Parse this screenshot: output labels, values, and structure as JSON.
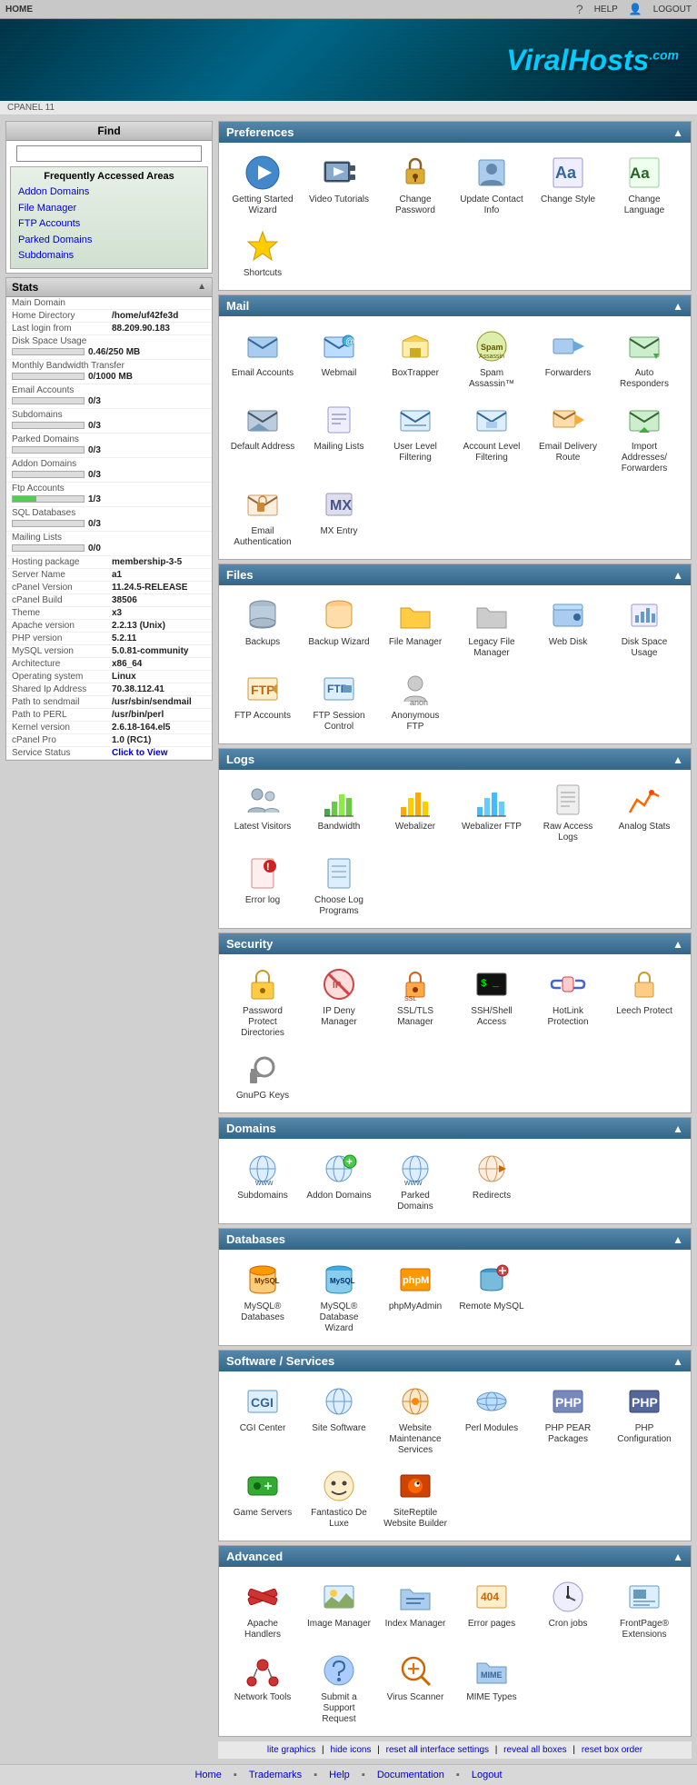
{
  "topbar": {
    "left": "HOME",
    "help": "HELP",
    "logout": "LOGOUT"
  },
  "header": {
    "logo_viral": "Viral",
    "logo_hosts": "Hosts",
    "logo_com": ".com"
  },
  "cpanel_bar": {
    "text": "CPANEL 11"
  },
  "sidebar": {
    "find_title": "Find",
    "find_placeholder": "",
    "freq_title": "Frequently Accessed Areas",
    "freq_links": [
      "Addon Domains",
      "File Manager",
      "FTP Accounts",
      "Parked Domains",
      "Subdomains"
    ],
    "stats_title": "Stats",
    "stats": {
      "main_domain_label": "Main Domain",
      "main_domain_val": "",
      "home_dir_label": "Home Directory",
      "home_dir_val": "/home/uf42fe3d",
      "last_login_label": "Last login from",
      "last_login_val": "88.209.90.183",
      "disk_label": "Disk Space Usage",
      "disk_val": "0.46/250 MB",
      "disk_pct": 0,
      "bandwidth_label": "Monthly Bandwidth Transfer",
      "bandwidth_val": "0/1000 MB",
      "bandwidth_pct": 0,
      "email_label": "Email Accounts",
      "email_val": "0/3",
      "email_pct": 0,
      "subdomains_label": "Subdomains",
      "subdomains_val": "0/3",
      "subdomains_pct": 0,
      "parked_label": "Parked Domains",
      "parked_val": "0/3",
      "parked_pct": 0,
      "addon_label": "Addon Domains",
      "addon_val": "0/3",
      "addon_pct": 0,
      "ftp_label": "Ftp Accounts",
      "ftp_val": "1/3",
      "ftp_pct": 33,
      "sql_label": "SQL Databases",
      "sql_val": "0/3",
      "sql_pct": 0,
      "mailing_label": "Mailing Lists",
      "mailing_val": "0/0",
      "mailing_pct": 0,
      "hosting_pkg_label": "Hosting package",
      "hosting_pkg_val": "membership-3-5",
      "server_label": "Server Name",
      "server_val": "a1",
      "cpanel_ver_label": "cPanel Version",
      "cpanel_ver_val": "11.24.5-RELEASE",
      "cpanel_build_label": "cPanel Build",
      "cpanel_build_val": "38506",
      "theme_label": "Theme",
      "theme_val": "x3",
      "apache_label": "Apache version",
      "apache_val": "2.2.13 (Unix)",
      "php_label": "PHP version",
      "php_val": "5.2.11",
      "mysql_label": "MySQL version",
      "mysql_val": "5.0.81-community",
      "arch_label": "Architecture",
      "arch_val": "x86_64",
      "os_label": "Operating system",
      "os_val": "Linux",
      "shared_ip_label": "Shared Ip Address",
      "shared_ip_val": "70.38.112.41",
      "path_sendmail_label": "Path to sendmail",
      "path_sendmail_val": "/usr/sbin/sendmail",
      "path_perl_label": "Path to PERL",
      "path_perl_val": "/usr/bin/perl",
      "kernel_label": "Kernel version",
      "kernel_val": "2.6.18-164.el5",
      "cpanel_pro_label": "cPanel Pro",
      "cpanel_pro_val": "1.0 (RC1)",
      "service_label": "Service Status",
      "service_val": "Click to View"
    }
  },
  "panels": {
    "preferences": {
      "title": "Preferences",
      "items": [
        {
          "label": "Getting Started Wizard",
          "icon": "▶",
          "color": "ico-blue"
        },
        {
          "label": "Video Tutorials",
          "icon": "🎬",
          "color": "ico-blue"
        },
        {
          "label": "Change Password",
          "icon": "🔑",
          "color": "ico-orange"
        },
        {
          "label": "Update Contact Info",
          "icon": "👤",
          "color": "ico-blue"
        },
        {
          "label": "Change Style",
          "icon": "Aa",
          "color": "ico-purple"
        },
        {
          "label": "Change Language",
          "icon": "Aa",
          "color": "ico-teal"
        },
        {
          "label": "Shortcuts",
          "icon": "★",
          "color": "ico-gold"
        }
      ]
    },
    "mail": {
      "title": "Mail",
      "items": [
        {
          "label": "Email Accounts",
          "icon": "✉",
          "color": "ico-blue"
        },
        {
          "label": "Webmail",
          "icon": "📧",
          "color": "ico-blue"
        },
        {
          "label": "BoxTrapper",
          "icon": "📬",
          "color": "ico-orange"
        },
        {
          "label": "Spam Assassin™",
          "icon": "🛡",
          "color": "ico-red"
        },
        {
          "label": "Forwarders",
          "icon": "➡",
          "color": "ico-green"
        },
        {
          "label": "Auto Responders",
          "icon": "↩",
          "color": "ico-teal"
        },
        {
          "label": "Default Address",
          "icon": "📩",
          "color": "ico-blue"
        },
        {
          "label": "Mailing Lists",
          "icon": "📋",
          "color": "ico-gray"
        },
        {
          "label": "User Level Filtering",
          "icon": "🔍",
          "color": "ico-blue"
        },
        {
          "label": "Account Level Filtering",
          "icon": "🔍",
          "color": "ico-blue"
        },
        {
          "label": "Email Delivery Route",
          "icon": "📤",
          "color": "ico-orange"
        },
        {
          "label": "Import Addresses/ Forwarders",
          "icon": "📥",
          "color": "ico-green"
        },
        {
          "label": "Email Authentication",
          "icon": "🔒",
          "color": "ico-orange"
        },
        {
          "label": "MX Entry",
          "icon": "⚙",
          "color": "ico-gray"
        }
      ]
    },
    "files": {
      "title": "Files",
      "items": [
        {
          "label": "Backups",
          "icon": "💾",
          "color": "ico-blue"
        },
        {
          "label": "Backup Wizard",
          "icon": "💾",
          "color": "ico-orange"
        },
        {
          "label": "File Manager",
          "icon": "📁",
          "color": "ico-gold"
        },
        {
          "label": "Legacy File Manager",
          "icon": "📂",
          "color": "ico-gray"
        },
        {
          "label": "Web Disk",
          "icon": "🖥",
          "color": "ico-blue"
        },
        {
          "label": "Disk Space Usage",
          "icon": "📊",
          "color": "ico-teal"
        },
        {
          "label": "FTP Accounts",
          "icon": "📡",
          "color": "ico-orange"
        },
        {
          "label": "FTP Session Control",
          "icon": "🔧",
          "color": "ico-blue"
        },
        {
          "label": "Anonymous FTP",
          "icon": "👤",
          "color": "ico-gray"
        }
      ]
    },
    "logs": {
      "title": "Logs",
      "items": [
        {
          "label": "Latest Visitors",
          "icon": "👥",
          "color": "ico-blue"
        },
        {
          "label": "Bandwidth",
          "icon": "📈",
          "color": "ico-green"
        },
        {
          "label": "Webalizer",
          "icon": "📊",
          "color": "ico-gold"
        },
        {
          "label": "Webalizer FTP",
          "icon": "📊",
          "color": "ico-teal"
        },
        {
          "label": "Raw Access Logs",
          "icon": "📄",
          "color": "ico-gray"
        },
        {
          "label": "Analog Stats",
          "icon": "📉",
          "color": "ico-orange"
        },
        {
          "label": "Error log",
          "icon": "⚠",
          "color": "ico-red"
        },
        {
          "label": "Choose Log Programs",
          "icon": "📋",
          "color": "ico-blue"
        }
      ]
    },
    "security": {
      "title": "Security",
      "items": [
        {
          "label": "Password Protect Directories",
          "icon": "🔒",
          "color": "ico-gold"
        },
        {
          "label": "IP Deny Manager",
          "icon": "🚫",
          "color": "ico-red"
        },
        {
          "label": "SSL/TLS Manager",
          "icon": "🔐",
          "color": "ico-orange"
        },
        {
          "label": "SSH/Shell Access",
          "icon": "💻",
          "color": "ico-gray"
        },
        {
          "label": "HotLink Protection",
          "icon": "🔗",
          "color": "ico-blue"
        },
        {
          "label": "Leech Protect",
          "icon": "🔒",
          "color": "ico-orange"
        },
        {
          "label": "GnuPG Keys",
          "icon": "🔑",
          "color": "ico-gray"
        }
      ]
    },
    "domains": {
      "title": "Domains",
      "items": [
        {
          "label": "Subdomains",
          "icon": "🌐",
          "color": "ico-blue"
        },
        {
          "label": "Addon Domains",
          "icon": "🌐",
          "color": "ico-blue"
        },
        {
          "label": "Parked Domains",
          "icon": "🌐",
          "color": "ico-teal"
        },
        {
          "label": "Redirects",
          "icon": "🌐",
          "color": "ico-orange"
        }
      ]
    },
    "databases": {
      "title": "Databases",
      "items": [
        {
          "label": "MySQL® Databases",
          "icon": "🐬",
          "color": "ico-blue"
        },
        {
          "label": "MySQL® Database Wizard",
          "icon": "🐬",
          "color": "ico-teal"
        },
        {
          "label": "phpMyAdmin",
          "icon": "🔧",
          "color": "ico-orange"
        },
        {
          "label": "Remote MySQL",
          "icon": "🐬",
          "color": "ico-blue"
        }
      ]
    },
    "software": {
      "title": "Software / Services",
      "items": [
        {
          "label": "CGI Center",
          "icon": "⚙",
          "color": "ico-blue"
        },
        {
          "label": "Site Software",
          "icon": "🌐",
          "color": "ico-teal"
        },
        {
          "label": "Website Maintenance Services",
          "icon": "🔧",
          "color": "ico-orange"
        },
        {
          "label": "Perl Modules",
          "icon": "🐪",
          "color": "ico-gray"
        },
        {
          "label": "PHP PEAR Packages",
          "icon": "🐘",
          "color": "ico-blue"
        },
        {
          "label": "PHP Configuration",
          "icon": "🐘",
          "color": "ico-teal"
        },
        {
          "label": "Game Servers",
          "icon": "🎮",
          "color": "ico-green"
        },
        {
          "label": "Fantastico De Luxe",
          "icon": "😊",
          "color": "ico-blue"
        },
        {
          "label": "SiteReptile Website Builder",
          "icon": "🦎",
          "color": "ico-orange"
        }
      ]
    },
    "advanced": {
      "title": "Advanced",
      "items": [
        {
          "label": "Apache Handlers",
          "icon": "⚡",
          "color": "ico-red"
        },
        {
          "label": "Image Manager",
          "icon": "🖼",
          "color": "ico-blue"
        },
        {
          "label": "Index Manager",
          "icon": "📋",
          "color": "ico-teal"
        },
        {
          "label": "Error pages",
          "icon": "⚠",
          "color": "ico-orange"
        },
        {
          "label": "Cron jobs",
          "icon": "⏰",
          "color": "ico-gray"
        },
        {
          "label": "FrontPage® Extensions",
          "icon": "🔧",
          "color": "ico-blue"
        },
        {
          "label": "Network Tools",
          "icon": "🌐",
          "color": "ico-red"
        },
        {
          "label": "Submit a Support Request",
          "icon": "💬",
          "color": "ico-blue"
        },
        {
          "label": "Virus Scanner",
          "icon": "🔬",
          "color": "ico-orange"
        },
        {
          "label": "MIME Types",
          "icon": "📄",
          "color": "ico-teal"
        }
      ]
    }
  },
  "bottom_links": {
    "items": [
      "lite graphics",
      "hide icons",
      "reset all interface settings",
      "reveal all boxes",
      "reset box order"
    ]
  },
  "footer_nav": {
    "items": [
      "Home",
      "Trademarks",
      "Help",
      "Documentation",
      "Logout"
    ]
  }
}
